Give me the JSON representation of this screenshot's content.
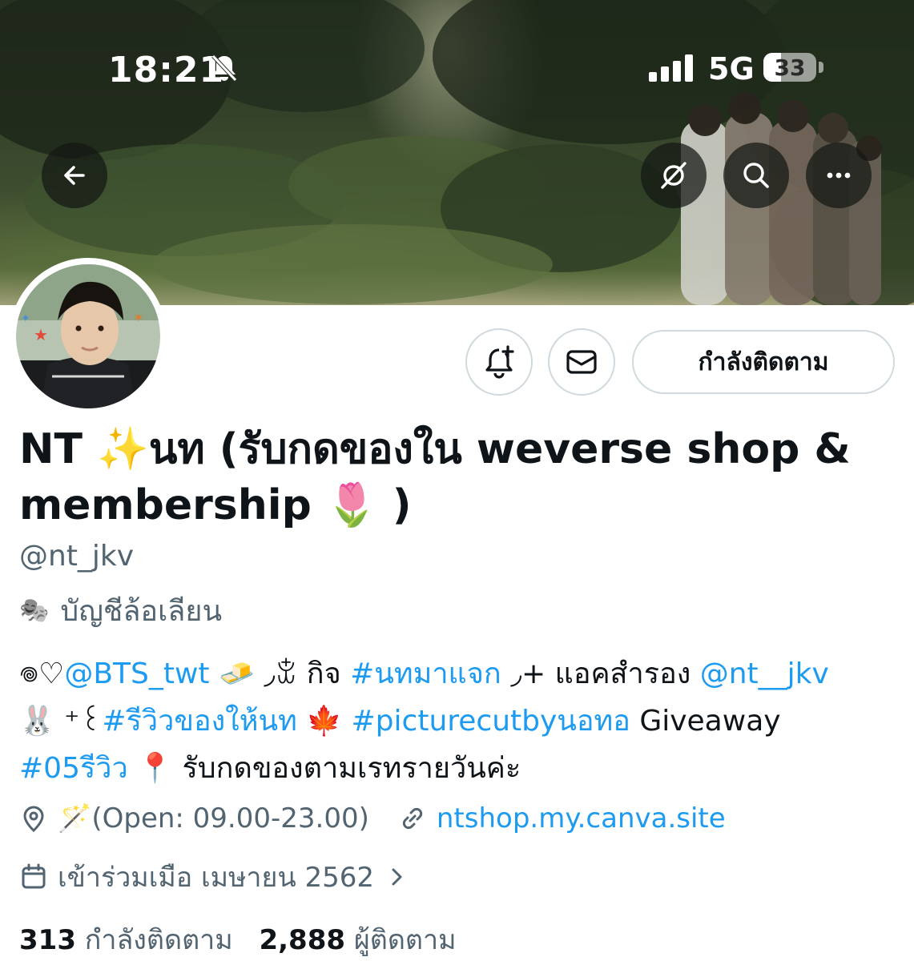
{
  "status_bar": {
    "time": "18:21",
    "network": "5G",
    "battery": "33",
    "battery_level_percent": 33
  },
  "banner_buttons": {
    "back": "back-arrow-icon",
    "grok": "grok-icon",
    "search": "search-icon",
    "more": "more-icon"
  },
  "actions": {
    "notify": "bell-plus-icon",
    "message": "mail-icon",
    "following_label": "กำลังติดตาม"
  },
  "profile": {
    "name_line1": "NT ✨นท (รับกดของใน weverse shop &",
    "name_line2": "membership 🌷 )",
    "handle": "@nt_jkv",
    "parody_label": "บัญชีล้อเลียน"
  },
  "bio": {
    "l1_a": "𖦹♡",
    "l1_mention1": "@BTS_twt",
    "l1_b": " 🧈 ◞ꒃ กิจ ",
    "l1_tag1": "#นทมาแจก",
    "l1_c": " ◞+ แอคสำรอง ",
    "l1_mention2": "@nt__jkv",
    "l2_a": "🐰 ⁺꒰",
    "l2_tag1": "#รีวิวของให้นท",
    "l2_b": " 🍁 ",
    "l2_tag2": "#picturecutbyนอทอ",
    "l2_c": " Giveaway",
    "l3_tag1": "#05รีวิว",
    "l3_b": " 📍 รับกดของตามเรทรายวันค่ะ"
  },
  "meta": {
    "location": "🪄(Open: 09.00-23.00)",
    "link": "ntshop.my.canva.site",
    "joined": "เข้าร่วมเมือ เมษายน 2562"
  },
  "stats": {
    "following_count": "313",
    "following_label": "กำลังติดตาม",
    "followers_count": "2,888",
    "followers_label": "ผู้ติดตาม"
  },
  "colors": {
    "accent": "#1d9bf0",
    "secondary_text": "#536471",
    "border": "#cfd9de"
  }
}
